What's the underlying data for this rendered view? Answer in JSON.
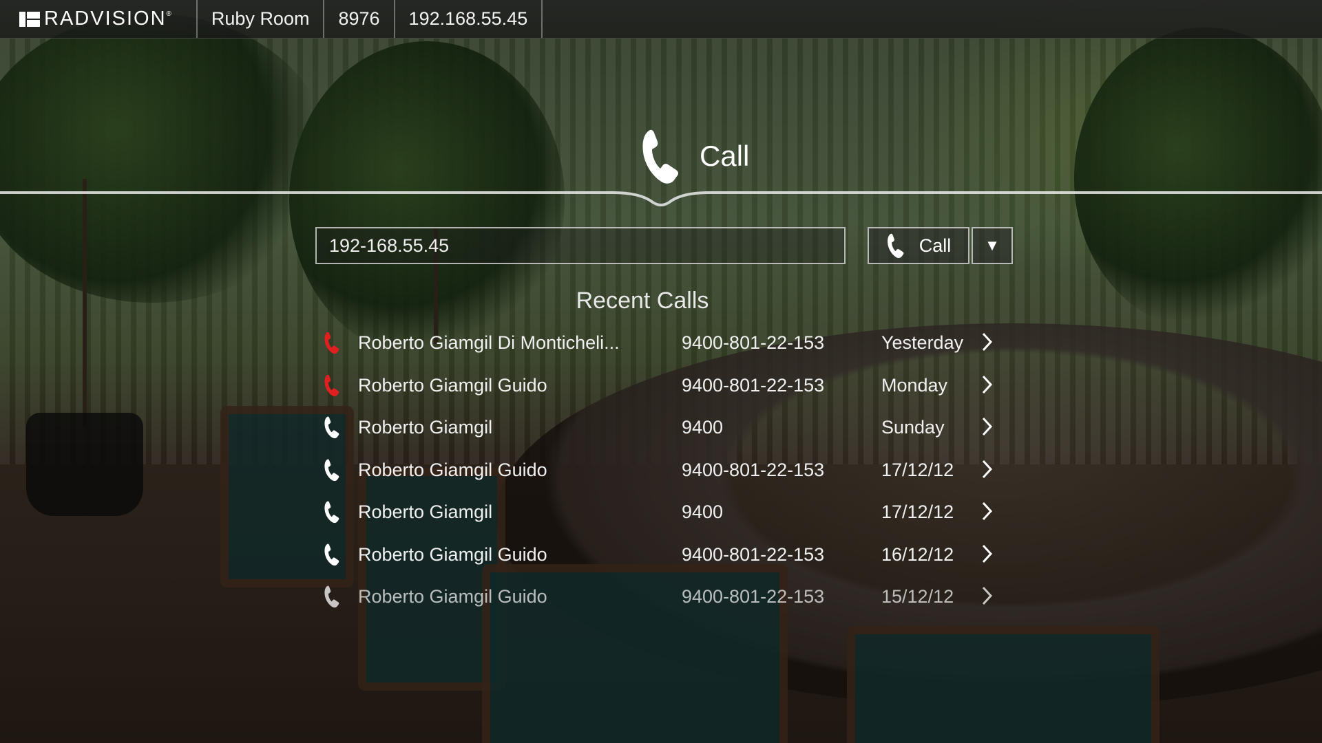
{
  "topbar": {
    "brand": "RADVISION",
    "room": "Ruby Room",
    "extension": "8976",
    "ip": "192.168.55.45"
  },
  "header": {
    "title": "Call",
    "icon": "phone-icon"
  },
  "dial": {
    "value": "192-168.55.45",
    "call_label": "Call",
    "dropdown_glyph": "▼"
  },
  "recent": {
    "title": "Recent Calls",
    "items": [
      {
        "name": "Roberto Giamgil Di Monticheli...",
        "number": "9400-801-22-153",
        "date": "Yesterday",
        "missed": true
      },
      {
        "name": "Roberto Giamgil Guido",
        "number": "9400-801-22-153",
        "date": "Monday",
        "missed": true
      },
      {
        "name": "Roberto Giamgil",
        "number": "9400",
        "date": "Sunday",
        "missed": false
      },
      {
        "name": "Roberto Giamgil Guido",
        "number": "9400-801-22-153",
        "date": "17/12/12",
        "missed": false
      },
      {
        "name": "Roberto Giamgil",
        "number": "9400",
        "date": "17/12/12",
        "missed": false
      },
      {
        "name": "Roberto Giamgil Guido",
        "number": "9400-801-22-153",
        "date": "16/12/12",
        "missed": false
      },
      {
        "name": "Roberto Giamgil Guido",
        "number": "9400-801-22-153",
        "date": "15/12/12",
        "missed": false
      }
    ]
  },
  "colors": {
    "missed": "#e02020",
    "normal": "#ffffff",
    "accent": "#ffffff"
  }
}
